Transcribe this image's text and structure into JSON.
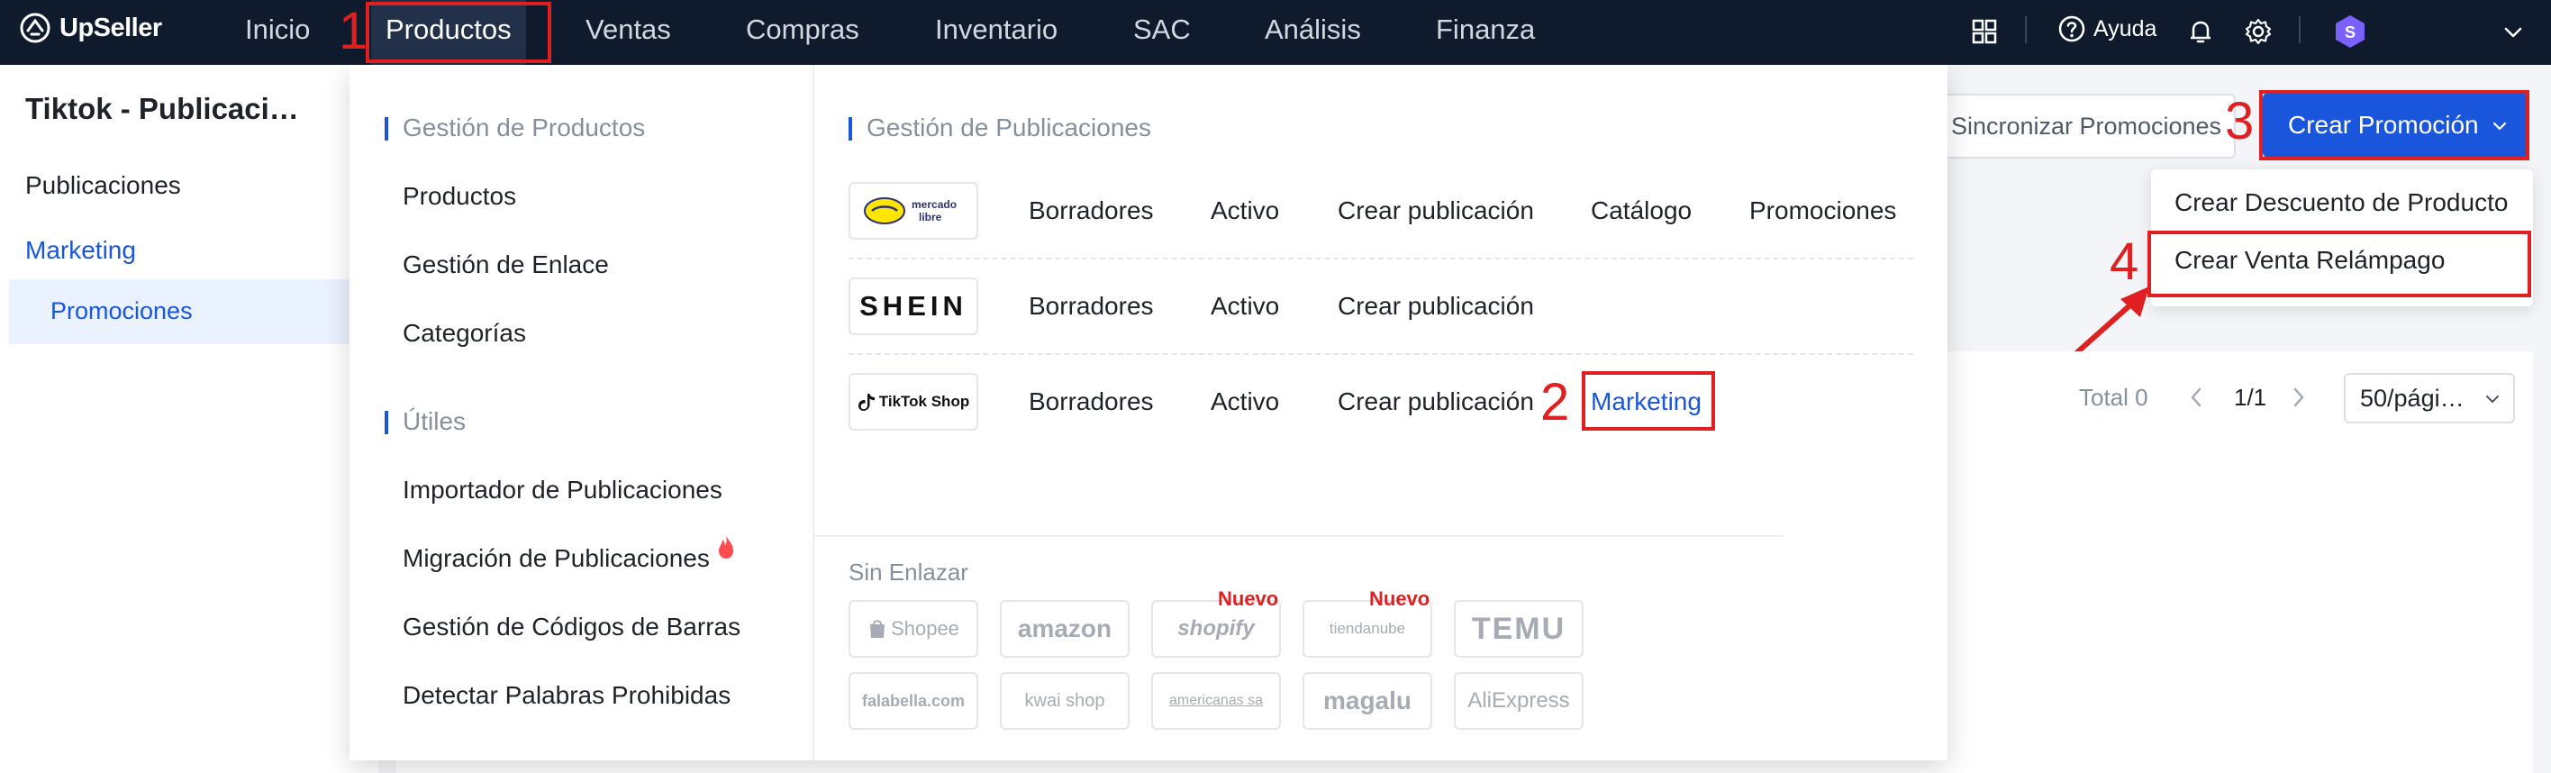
{
  "app": {
    "name": "UpSeller"
  },
  "nav": {
    "items": [
      "Inicio",
      "Productos",
      "Ventas",
      "Compras",
      "Inventario",
      "SAC",
      "Análisis",
      "Finanza"
    ],
    "help_label": "Ayuda",
    "avatar_initial": "S"
  },
  "sidebar": {
    "title": "Tiktok - Publicaci…",
    "items": [
      "Publicaciones",
      "Marketing"
    ],
    "sub_item": "Promociones"
  },
  "mega_menu": {
    "product_group_title": "Gestión de Productos",
    "product_items": [
      "Productos",
      "Gestión de Enlace",
      "Categorías"
    ],
    "tools_group_title": "Útiles",
    "tools_items": [
      "Importador de Publicaciones",
      "Migración de Publicaciones",
      "Gestión de Códigos de Barras",
      "Detectar Palabras Prohibidas"
    ],
    "listing_group_title": "Gestión de Publicaciones",
    "platforms": [
      {
        "name": "mercado libre",
        "links": [
          "Borradores",
          "Activo",
          "Crear publicación",
          "Catálogo",
          "Promociones"
        ]
      },
      {
        "name": "SHEIN",
        "links": [
          "Borradores",
          "Activo",
          "Crear publicación"
        ]
      },
      {
        "name": "TikTok Shop",
        "links": [
          "Borradores",
          "Activo",
          "Crear publicación",
          "Marketing"
        ]
      }
    ],
    "unlinked_title": "Sin Enlazar",
    "unlinked": [
      "Shopee",
      "amazon",
      "shopify",
      "tiendanube",
      "TEMU",
      "falabella.com",
      "kwai shop",
      "americanas sa",
      "magalu",
      "AliExpress"
    ],
    "new_badge": "Nuevo"
  },
  "toolbar": {
    "sync_label": "Sincronizar Promociones",
    "create_label": "Crear Promoción"
  },
  "create_dropdown": {
    "items": [
      "Crear Descuento de Producto",
      "Crear Venta Relámpago"
    ]
  },
  "pagination": {
    "total": "Total 0",
    "page": "1/1",
    "page_size": "50/pági…"
  },
  "annotations": {
    "steps": [
      "1",
      "2",
      "3",
      "4"
    ],
    "color": "#e02020"
  },
  "colors": {
    "topbar": "#0f1b2d",
    "primary": "#1a56db",
    "accent_red": "#e02020"
  }
}
